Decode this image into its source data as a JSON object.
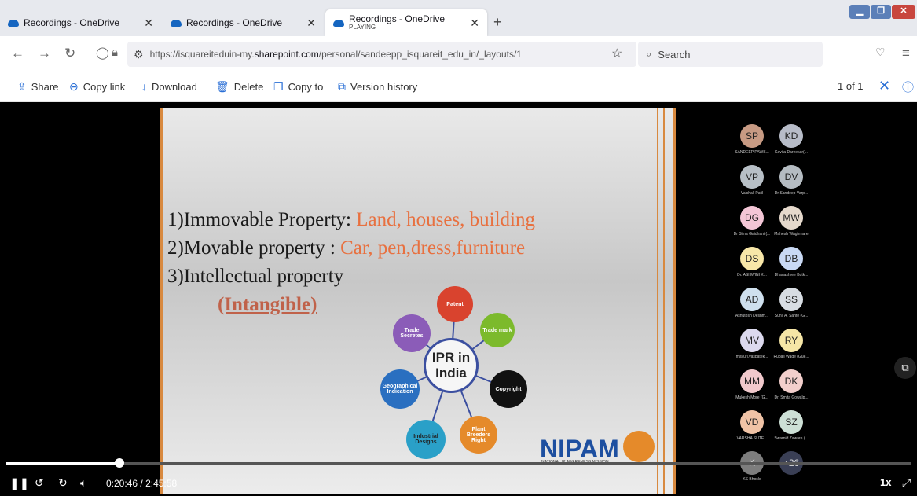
{
  "browser": {
    "tabs": [
      {
        "title": "Recordings - OneDrive",
        "subtitle": ""
      },
      {
        "title": "Recordings - OneDrive",
        "subtitle": ""
      },
      {
        "title": "Recordings - OneDrive",
        "subtitle": "PLAYING"
      }
    ],
    "new_tab": "+",
    "url_prefix": "https://isquareiteduin-my.",
    "url_domain": "sharepoint.com",
    "url_path": "/personal/sandeepp_isquareit_edu_in/_layouts/1",
    "search_placeholder": "Search"
  },
  "toolbar": {
    "share": "Share",
    "copy_link": "Copy link",
    "download": "Download",
    "delete": "Delete",
    "copy_to": "Copy to",
    "version_history": "Version history",
    "page_count": "1 of 1"
  },
  "slide": {
    "line1_prefix": "1)Immovable  Property: ",
    "line1_highlight": "Land, houses, building",
    "line2_prefix": "2)Movable property : ",
    "line2_highlight": "Car, pen,dress,furniture",
    "line3": "3)Intellectual property",
    "line4": "(Intangible)",
    "hub_line1": "IPR in",
    "hub_line2": "India",
    "nodes": [
      "Patent",
      "Trade mark",
      "Copyright",
      "Plant Breeders Right",
      "Industrial Designs",
      "Geographical Indication",
      "Trade Secretes"
    ],
    "logo": "NIPAM",
    "logo_sub": "NATIONAL IP AWARENESS MISSION"
  },
  "participants": [
    {
      "initials": "SP",
      "name": "SANDEEP PAWS...",
      "color": "#c79a83"
    },
    {
      "initials": "KD",
      "name": "Kavita Dareekar(...",
      "color": "#b7bcc8"
    },
    {
      "initials": "VP",
      "name": "Vaishali Patil",
      "color": "#b7bfc6"
    },
    {
      "initials": "DV",
      "name": "Dr Sandeep Varp...",
      "color": "#b5bcc2"
    },
    {
      "initials": "DG",
      "name": "Dr Sima Gaidhani (...",
      "color": "#f3c6d6"
    },
    {
      "initials": "MW",
      "name": "Mahesh Waghmare",
      "color": "#e5d9cc"
    },
    {
      "initials": "DS",
      "name": "Dr. ASHWINI K...",
      "color": "#f8e7a8"
    },
    {
      "initials": "DB",
      "name": "Dhanashree Butk...",
      "color": "#c9d9f4"
    },
    {
      "initials": "AD",
      "name": "Ashutosh Deshm...",
      "color": "#cfe0ee"
    },
    {
      "initials": "SS",
      "name": "Sunil A. Sante (G...",
      "color": "#d8dde3"
    },
    {
      "initials": "MV",
      "name": "mayuri.vaspatek...",
      "color": "#dcd9ee"
    },
    {
      "initials": "RY",
      "name": "Rupali Wade (Gue...",
      "color": "#f6e6a6"
    },
    {
      "initials": "MM",
      "name": "Mukesh More (G...",
      "color": "#f1c9cc"
    },
    {
      "initials": "DK",
      "name": "Dr. Smita Gowalp...",
      "color": "#f3cfcc"
    },
    {
      "initials": "VD",
      "name": "VARSHA SUTE...",
      "color": "#f0c3a6"
    },
    {
      "initials": "SZ",
      "name": "Swarnid Zaware (...",
      "color": "#cde0d6"
    },
    {
      "initials": "K",
      "name": "KS Bhosle",
      "color": "#7d7d7d"
    },
    {
      "initials": "+26",
      "name": "",
      "color": "#3a3f55"
    }
  ],
  "player": {
    "current_time": "0:20:46",
    "separator": "/",
    "duration": "2:45:58",
    "progress": 0.125,
    "speed": "1x"
  }
}
